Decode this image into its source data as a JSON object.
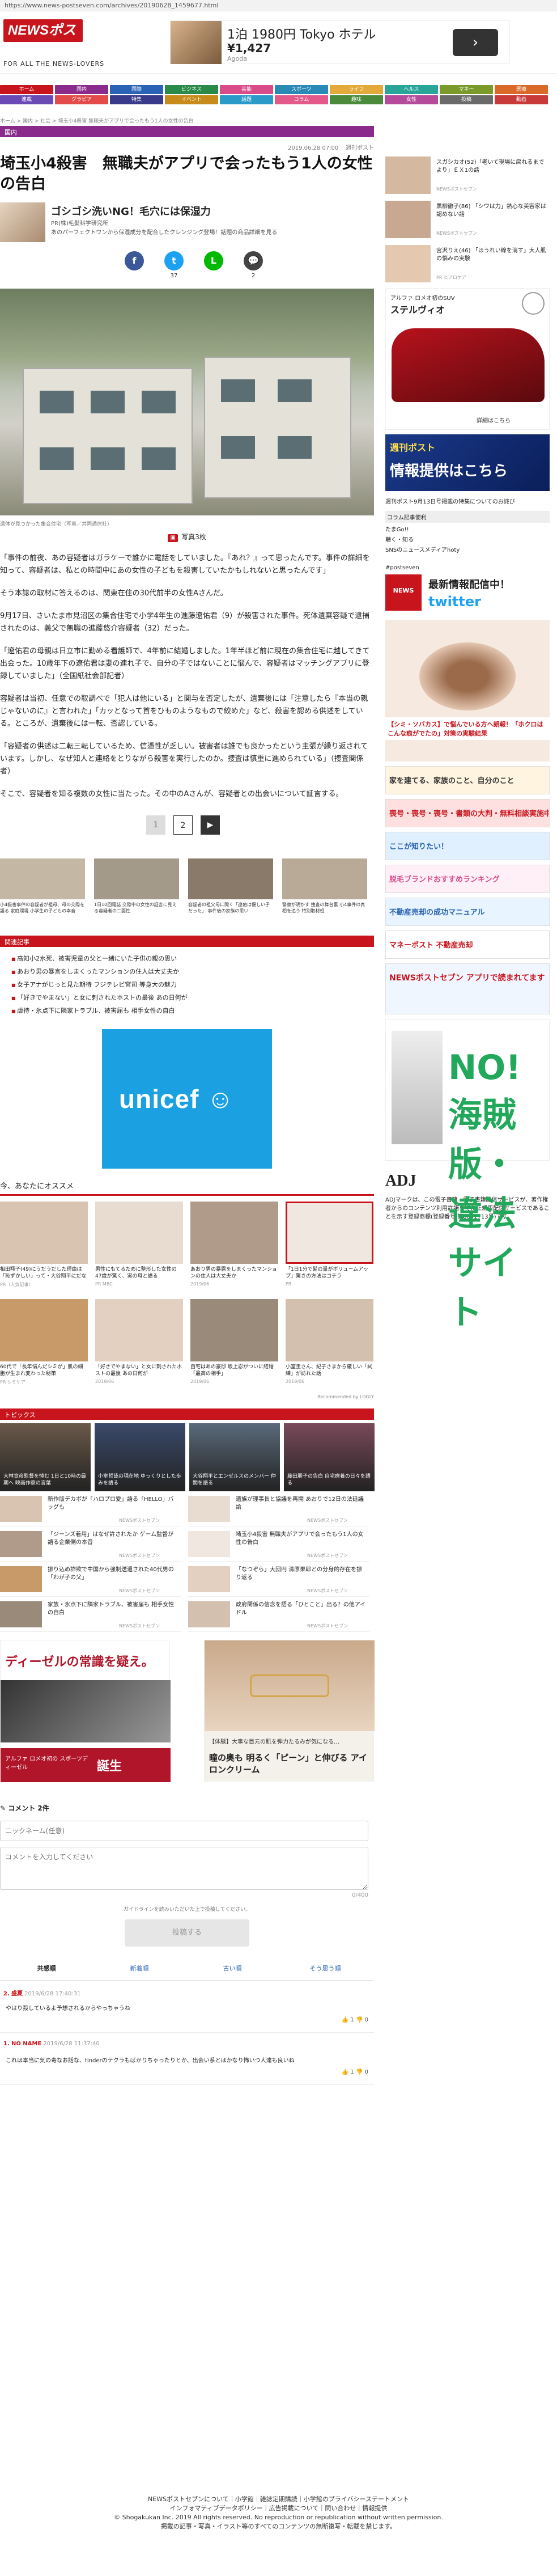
{
  "url": "https://www.news-postseven.com/archives/20190628_1459677.html",
  "logo": "NEWSポストセブン",
  "logo_tag": "FOR ALL THE NEWS-LOVERS",
  "top_ad": {
    "line1": "1泊 1980円 Tokyo ホテル",
    "line2": "¥1,427",
    "line3": "Agoda",
    "go": "›"
  },
  "nav": [
    {
      "label": "ホーム",
      "color": "#c8151d"
    },
    {
      "label": "国内",
      "color": "#8a2a8a"
    },
    {
      "label": "国際",
      "color": "#2a62b5"
    },
    {
      "label": "ビジネス",
      "color": "#2a8a4a"
    },
    {
      "label": "芸能",
      "color": "#d94c8a"
    },
    {
      "label": "スポーツ",
      "color": "#2a8ab5"
    },
    {
      "label": "ライフ",
      "color": "#e3a93a"
    },
    {
      "label": "ヘルス",
      "color": "#2aa59a"
    },
    {
      "label": "マネー",
      "color": "#7a9a2a"
    },
    {
      "label": "医療",
      "color": "#d96a2a"
    },
    {
      "label": "連載",
      "color": "#6a4ab5"
    },
    {
      "label": "グラビア",
      "color": "#e34a4a"
    },
    {
      "label": "特集",
      "color": "#3a3a8a"
    },
    {
      "label": "イベント",
      "color": "#c88a1a"
    },
    {
      "label": "話題",
      "color": "#2a9ac8"
    },
    {
      "label": "コラム",
      "color": "#e35a8a"
    },
    {
      "label": "趣味",
      "color": "#4a8a3a"
    },
    {
      "label": "女性",
      "color": "#b54a9a"
    },
    {
      "label": "投稿",
      "color": "#6a6a6a"
    },
    {
      "label": "動画",
      "color": "#c83a3a"
    }
  ],
  "breadcrumb": "ホーム > 国内 > 社会 > 埼玉小4殺害 無職夫がアプリで会ったもう1人の女性の告白",
  "category": "国内",
  "date": "2019.06.28 07:00",
  "magazine": "週刊ポスト",
  "title": "埼玉小4殺害　無職夫がアプリで会ったもう1人の女性の告白",
  "promo": {
    "headline": "ゴシゴシ洗いNG！毛穴には保湿力",
    "label": "PR(株)毛髪科学研究所",
    "text": "あのパーフェクトワンから保湿成分を配合したクレンジング登場！話題の商品詳細を見る"
  },
  "shares": [
    {
      "icon": "f",
      "count": "",
      "color": "#3b5998"
    },
    {
      "icon": "t",
      "count": "37",
      "color": "#1da1f2"
    },
    {
      "icon": "L",
      "count": "",
      "color": "#00b900"
    },
    {
      "icon": "💬",
      "count": "2",
      "color": "#444"
    }
  ],
  "photo_caption": "遺体が見つかった集合住宅（写真／共同通信社）",
  "photo_count": "写真3枚",
  "paragraphs": [
    "「事件の前夜、あの容疑者はガラケーで誰かに電話をしていました。『あれ？』って思ったんです。事件の詳細を知って、容疑者は、私との時間中にあの女性の子どもを殺害していたかもしれないと思ったんです」",
    "そう本誌の取材に答えるのは、関東在住の30代前半の女性Aさんだ。",
    "9月17日、さいたま市見沼区の集合住宅で小学4年生の進藤遼佑君（9）が殺害された事件。死体遺棄容疑で逮捕されたのは、義父で無職の進藤悠介容疑者（32）だった。",
    "「遼佑君の母親は日立市に勤める看護師で、4年前に結婚しました。1年半ほど前に現在の集合住宅に越してきて出会った。10歳年下の遼佑君は妻の連れ子で、自分の子ではないことに悩んで、容疑者はマッチングアプリに登録していました」（全国紙社会部記者）",
    "容疑者は当初、任意での取調べで「犯人は他にいる」と関与を否定したが、遺棄後には「注意したら『本当の親じゃないのに』と言われた」「カッとなって首をひものようなもので絞めた」など、殺害を認める供述をしている。ところが、遺棄後には一転、否認している。",
    "「容疑者の供述は二転三転しているため、信憑性が乏しい。被害者は誰でも良かったという主張が繰り返されています。しかし、なぜ知人と連絡をとりながら殺害を実行したのか。捜査は慎重に進められている」（捜査関係者）",
    "そこで、容疑者を知る複数の女性に当たった。その中のAさんが、容疑者との出会いについて証言する。"
  ],
  "pager": {
    "current": "1",
    "next": "2",
    "arrow": "▶"
  },
  "thumbs": [
    "小4殺害事件の容疑者が祖母、母の交際を語る 家庭環境 小学生の子どもの本音",
    "1日10回電話 交際中の女性の証言に見える容疑者の二面性",
    "容疑者の祖父母に聞く「遼佑は優しい子だった」 事件後の家族の思い",
    "警察が明かす 捜査の舞台裏 小4事件の真相を追う 特別取材班"
  ],
  "related_title": "関連記事",
  "related": [
    "高知小2水死、被害児童の父と一緒にいた子供の親の思い",
    "あおり男の暴言をしまくったマンションの住人は大丈夫か",
    "女子アナがじっと見た期待 フジテレビ宮司 等身大の魅力",
    "「好きでやまない」と女に刺されたホストの最後 あの日何が",
    "虐待・氷点下に隣家トラブル、被害届も 相手女性の自白"
  ],
  "rec_title": "今、あなたにオススメ",
  "rec": [
    {
      "text": "相田翔子(49)にうだうだした理由は「恥ずかしい」って・大谷翔平にだな",
      "src": "PR（人気記事）"
    },
    {
      "text": "男性にもてるために整形した女性の47歳が驚く、実の母と語る",
      "src": "PR MBC"
    },
    {
      "text": "あおり男の暴露をしまくったマンションの住人は大丈夫か",
      "src": "2019/06"
    },
    {
      "text": "「1日1分で髪の量がボリュームアップ」驚きの方法はコチラ",
      "src": "PR"
    },
    {
      "text": "60代で「長年悩んだシミが」肌の細胞が生まれ変わった秘策",
      "src": "PR シミケア"
    },
    {
      "text": "「好きでやまない」と女に刺されたホストの最後 あの日何が",
      "src": "2019/06"
    },
    {
      "text": "自宅はあの豪邸 坂上忍がついに結婚「最高の相手」",
      "src": "2019/06"
    },
    {
      "text": "小室圭さん、紀子さまから厳しい「試練」が訪れた話",
      "src": "2019/06"
    }
  ],
  "logly": "Recommended by LOGLY",
  "topics_title": "トピックス",
  "topics_banner": [
    "大林宣彦監督を悼む 1日と10時の最期へ 映画作家の言葉",
    "小室哲哉の現在地 ゆっくりとした歩みを語る",
    "大谷翔平とエンゼルスのメンバー 仲間を語る",
    "藤田朋子の告白 自宅療養の日々を語る"
  ],
  "topics": [
    {
      "text": "新作版デカボが「ハロプロ愛」語る「HELLO」バッグも",
      "src": "NEWSポストセブン"
    },
    {
      "text": "遺族が理事長と協議を再開 あおりで12日の法廷議論",
      "src": "NEWSポストセブン"
    },
    {
      "text": "「ジーンズ着用」はなぜ許されたか ゲーム監督が語る企業側の本音",
      "src": "NEWSポストセブン"
    },
    {
      "text": "埼玉小4殺害 無職夫がアプリで会ったもう1人の女性の告白",
      "src": "NEWSポストセブン"
    },
    {
      "text": "振り込め詐欺で中国から強制送還された40代男の「わが子の父」",
      "src": "NEWSポストセブン"
    },
    {
      "text": "「なつぞら」大団円 清原果耶との分身的存在を振り返る",
      "src": "NEWSポストセブン"
    },
    {
      "text": "家族・氷点下に隣家トラブル、被害届も 相手女性の自白",
      "src": "NEWSポストセブン"
    },
    {
      "text": "政府関係の信念を語る「ひとこと」出る？の他アイドル",
      "src": "NEWSポストセブン"
    }
  ],
  "big_ad1": {
    "line1": "ディーゼルの常識を疑え。",
    "line2": "アルファ ロメオ初の スポーツディーゼル",
    "line3": "誕生"
  },
  "big_ad2": {
    "line1": "【体験】大事な目元の肌を弾力たるみが気になる…",
    "line2": "瞳の奥も 明るく「ピーン」と伸びる アイロンクリーム"
  },
  "comment_count": "コメント 2件",
  "nick_placeholder": "ニックネーム(任意)",
  "comment_placeholder": "コメントを入力してください",
  "char_count": "0/400",
  "guideline": "ガイドラインを読みいただいた上で投稿してください。",
  "post_btn": "投稿する",
  "cm_tabs": [
    "共感順",
    "新着順",
    "古い順",
    "そう思う順"
  ],
  "comments": [
    {
      "num": "2.",
      "name": "盛夏",
      "date": "2019/6/28 17:40:31",
      "text": "やはり殺しているよ予想されるからやっちゃうね",
      "up": "1",
      "down": "0"
    },
    {
      "num": "1.",
      "name": "NO NAME",
      "date": "2019/6/28 11:37:40",
      "text": "これは本当に気の毒なお話な、tinderのテクラもばかりちゃったりとか、出会い系とはかなり怖いつ人達も良いね",
      "up": "1",
      "down": "0"
    }
  ],
  "side": [
    {
      "text": "スガシカオ(52)「老いて現場に戻れるまでより」ＥＸ1の話",
      "src": "NEWSポストセブン"
    },
    {
      "text": "黒柳徹子(86) 「シワは力」熱心な美容家は認めない話",
      "src": "NEWSポストセブン"
    },
    {
      "text": "宮沢りえ(46) 「ほうれい線を消す」大人肌の悩みの実験",
      "src": "PR ヒアロケア"
    }
  ],
  "alfa_ad": {
    "line1": "アルファ ロメオ初のSUV",
    "line2": "ステルヴィオ",
    "line3": "詳細はこちら"
  },
  "info_banner": {
    "line1": "週刊ポスト",
    "line2": "情報提供はこちら"
  },
  "side_note": "週刊ポスト9月13日号掲載の特集についてのお詫び",
  "coupon_title": "コラム記事便利",
  "coupon_items": [
    "たまGo!!",
    "聴く・知る",
    "SNSのニュースメディアhoty"
  ],
  "tw_handle": "#postseven",
  "tw_line1": "最新情報配信中！",
  "tw_line2": "twitter",
  "skin_ad": "【シミ・ソバカス】で悩んでいる方へ朗報！「ホクロはこんな痕がでたの」対策の実験結果",
  "side_banners": [
    "家を建てる、家族のこと、自分のこと",
    "喪号・喪号・喪号・書類の大判・無料相談実施中",
    "ここが知りたい！",
    "脱毛ブランドおすすめランキング",
    "不動産売却の成功マニュアル",
    "マネーポスト 不動産売却",
    "NEWSポストセブン アプリで読まれてます"
  ],
  "noa_ad": "NO! 海賊版・違法サイト",
  "adj": "ADJ",
  "adj_text": "ADJマークは、この電子書籍・電子書籍配信サービスが、著作権者からのコンテンツ利用許諾を得た正規版配信サービスであることを示す登録商標(登録番号 第6091713号)です。",
  "footer": [
    "NEWSポストセブンについて｜小学館｜雑誌定期購読｜小学館のプライバシーステートメント",
    "インフォマティブデータポリシー｜広告掲載について｜問い合わせ｜情報提供",
    "© Shogakukan Inc. 2019 All rights reserved. No reproduction or republication without written permission.",
    "掲載の記事・写真・イラスト等のすべてのコンテンツの無断複写・転載を禁じます。"
  ]
}
